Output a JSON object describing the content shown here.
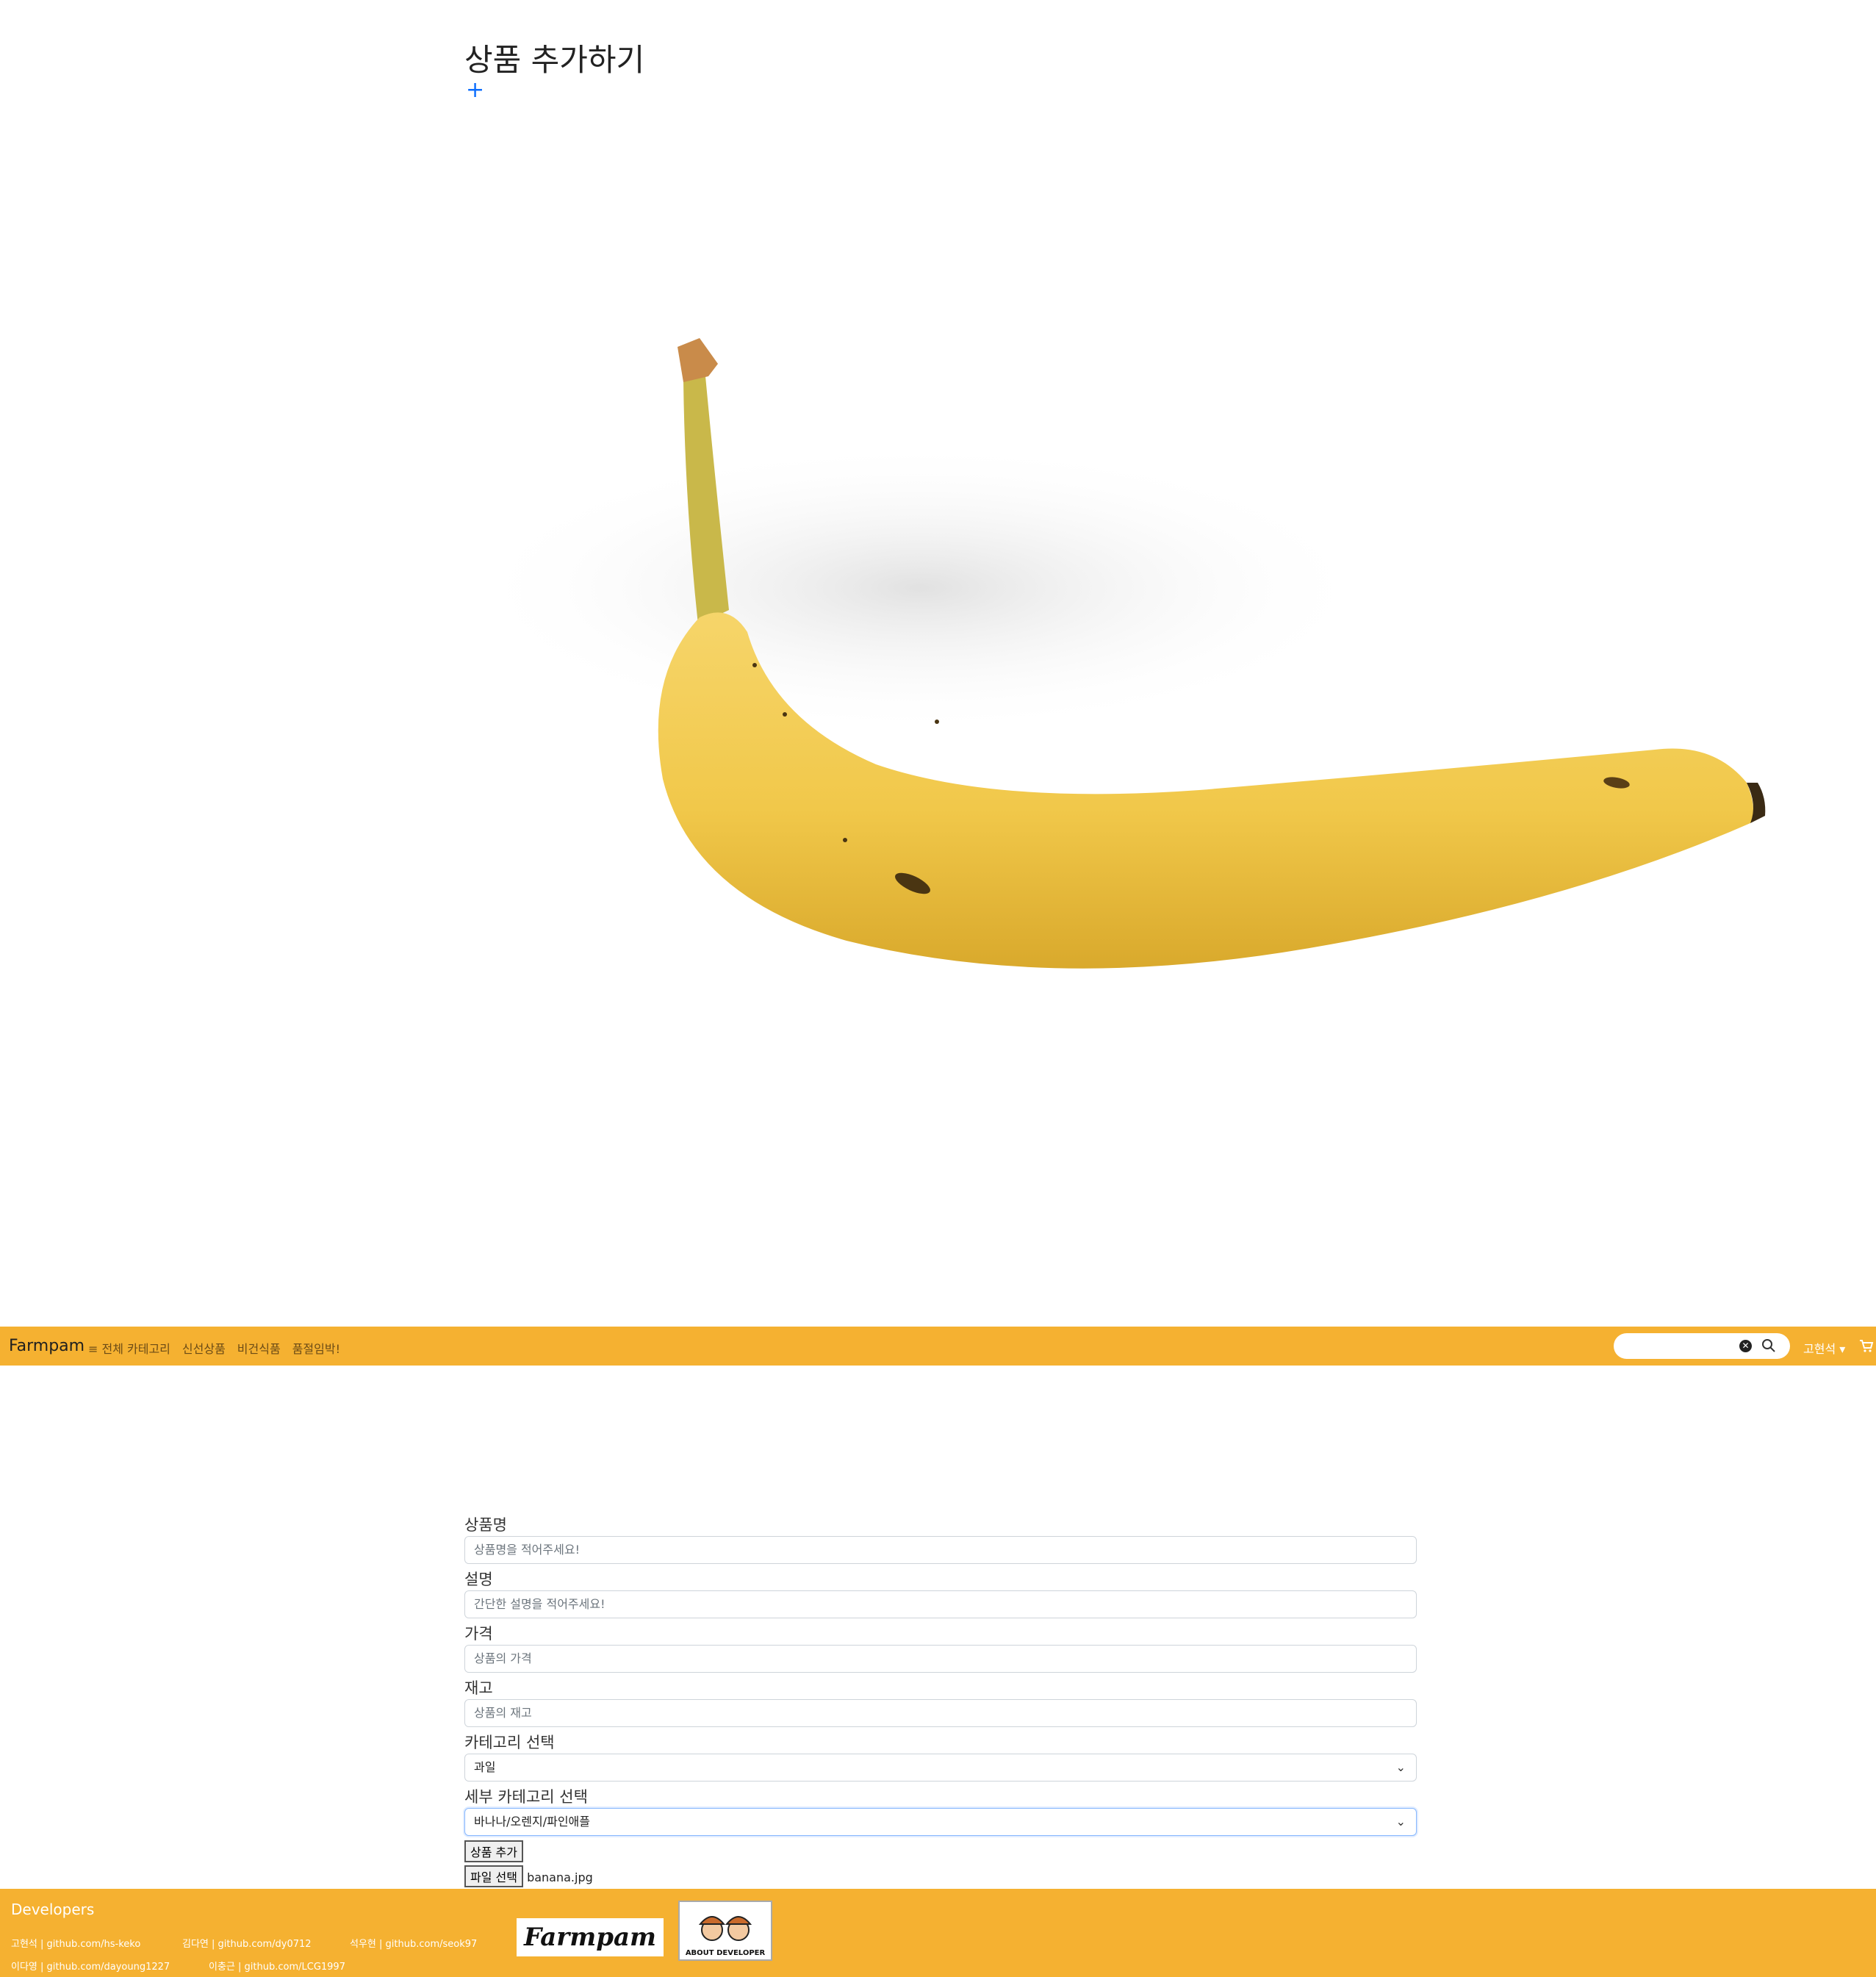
{
  "page": {
    "title": "상품 추가하기",
    "add_symbol": "+",
    "preview_alt": "banana"
  },
  "navbar": {
    "brand": "Farmpam",
    "links": [
      "≡ 전체 카테고리",
      "신선상품",
      "비건식품",
      "품절임박!"
    ],
    "search_placeholder": "",
    "user": "고현석 ▾",
    "accent": "#f5b131"
  },
  "form": {
    "name_label": "상품명",
    "name_placeholder": "상품명을 적어주세요!",
    "desc_label": "설명",
    "desc_placeholder": "간단한 설명을 적어주세요!",
    "price_label": "가격",
    "price_placeholder": "상품의 가격",
    "stock_label": "재고",
    "stock_placeholder": "상품의 재고",
    "category_label": "카테고리 선택",
    "category_value": "과일",
    "subcategory_label": "세부 카테고리 선택",
    "subcategory_value": "바나나/오렌지/파인애플",
    "submit_label": "상품 추가",
    "file_button": "파일 선택",
    "file_name": "banana.jpg"
  },
  "footer": {
    "title": "Developers",
    "devs": [
      "고현석 | github.com/hs-keko",
      "김다연 | github.com/dy0712",
      "석우현 | github.com/seok97",
      "이다영 | github.com/dayoung1227",
      "이충근 | github.com/LCG1997"
    ],
    "logo": "Farmpam",
    "about": "ABOUT DEVELOPER"
  }
}
